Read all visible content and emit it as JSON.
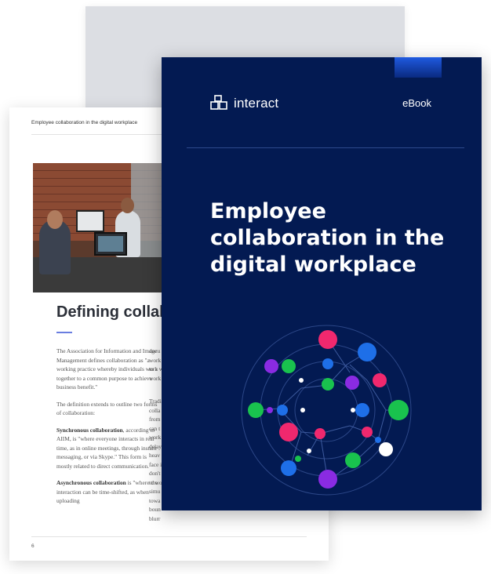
{
  "inner_page": {
    "header": "Employee collaboration in the digital workplace",
    "heading": "Defining collabo",
    "page_number": "6",
    "col1": [
      "The Association for Information and Image Management defines collaboration as \"a working practice whereby individuals work together to a common purpose to achieve business benefit.\"",
      "The definition extends to outline two forms of collaboration:",
      {
        "bold": "Synchronous collaboration",
        "text": ", according to AIIM, is \"where everyone interacts in real time, as in online meetings, through instant messaging, or via Skype.\" This form is mostly related to direct communication."
      },
      {
        "bold": "Asynchronous collaboration",
        "text": " is \"where the interaction can be time-shifted, as when uploading"
      }
    ],
    "col2_fragments": [
      "docu",
      "work",
      "to a w",
      "work",
      "",
      "Tradi",
      "colla",
      "from",
      "can t",
      "work",
      "delay",
      "heav",
      "face i",
      "don't",
      "to wo",
      "simu",
      "towa",
      "boun",
      "blurr"
    ]
  },
  "cover": {
    "brand": "interact",
    "badge": "eBook",
    "title_lines": [
      "Employee",
      "collaboration in the",
      "digital workplace"
    ]
  },
  "colors": {
    "cover_bg": "#031a52",
    "accent_blue": "#1f5ae0",
    "node_pink": "#f0286e",
    "node_purple": "#8a2be2",
    "node_green": "#19c24e",
    "node_blue": "#1e6fe8"
  }
}
